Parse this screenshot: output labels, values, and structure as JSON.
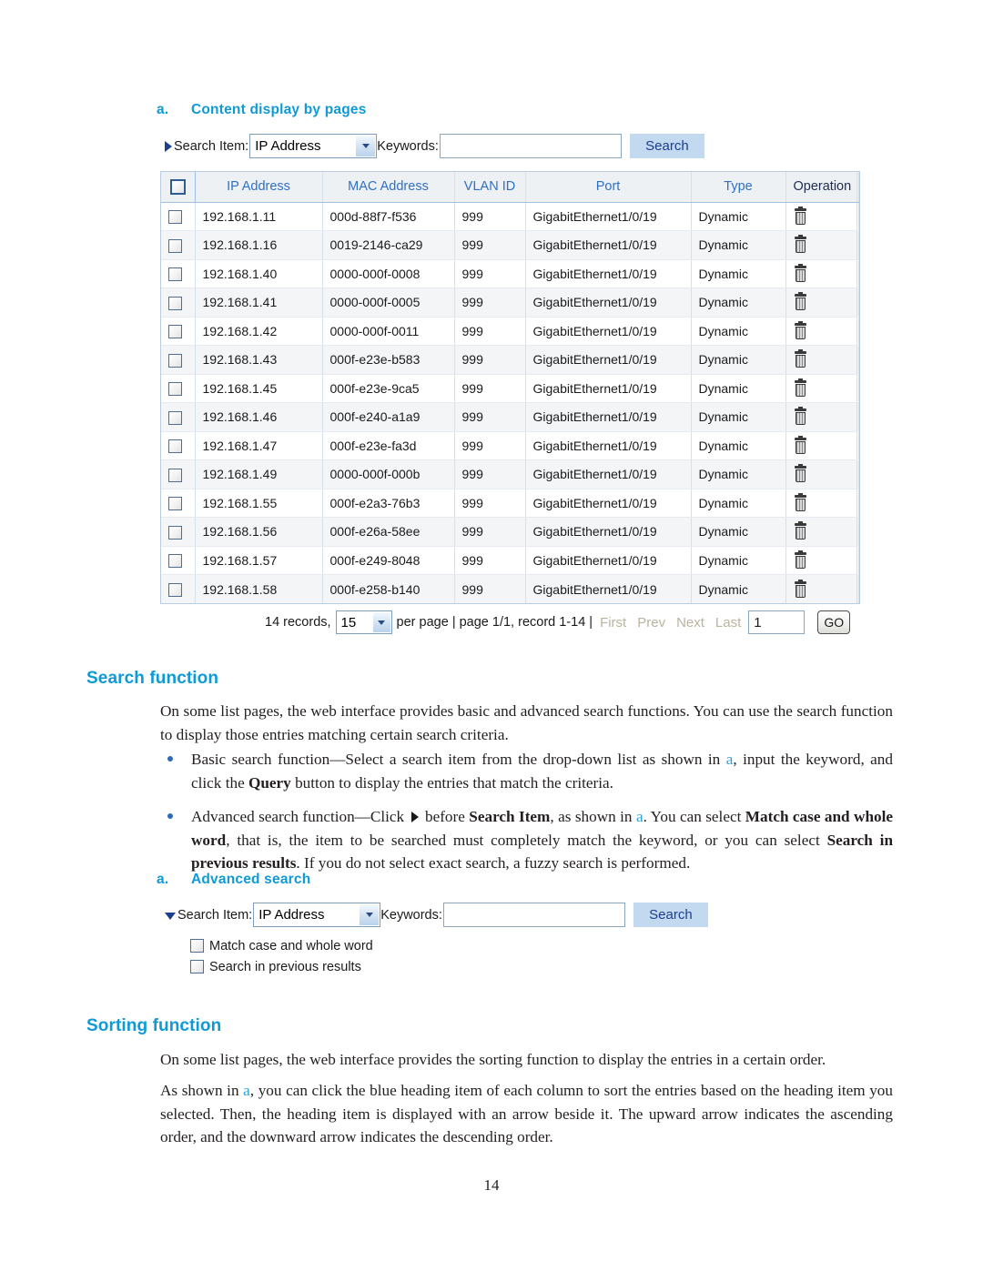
{
  "figure_a1": {
    "label": "a.",
    "title": "Content display by pages"
  },
  "figure_a2": {
    "label": "a.",
    "title": "Advanced search"
  },
  "search_bar": {
    "toggle_icon": "triangle-right-icon",
    "search_item_label": "Search Item:",
    "search_item_value": "IP Address",
    "keywords_label": "Keywords:",
    "keywords_value": "",
    "search_button": "Search"
  },
  "advanced_search_bar": {
    "toggle_icon": "triangle-down-icon",
    "search_item_label": "Search Item:",
    "search_item_value": "IP Address",
    "keywords_label": "Keywords:",
    "keywords_value": "",
    "search_button": "Search",
    "checkboxes": [
      {
        "label": "Match case and whole word",
        "checked": false
      },
      {
        "label": "Search in previous results",
        "checked": false
      }
    ]
  },
  "table": {
    "columns": [
      "IP Address",
      "MAC Address",
      "VLAN ID",
      "Port",
      "Type",
      "Operation"
    ],
    "select_all_checkbox": false,
    "delete_icon": "trash-icon",
    "rows": [
      {
        "ip": "192.168.1.11",
        "mac": "000d-88f7-f536",
        "vlan": "999",
        "port": "GigabitEthernet1/0/19",
        "type": "Dynamic"
      },
      {
        "ip": "192.168.1.16",
        "mac": "0019-2146-ca29",
        "vlan": "999",
        "port": "GigabitEthernet1/0/19",
        "type": "Dynamic"
      },
      {
        "ip": "192.168.1.40",
        "mac": "0000-000f-0008",
        "vlan": "999",
        "port": "GigabitEthernet1/0/19",
        "type": "Dynamic"
      },
      {
        "ip": "192.168.1.41",
        "mac": "0000-000f-0005",
        "vlan": "999",
        "port": "GigabitEthernet1/0/19",
        "type": "Dynamic"
      },
      {
        "ip": "192.168.1.42",
        "mac": "0000-000f-0011",
        "vlan": "999",
        "port": "GigabitEthernet1/0/19",
        "type": "Dynamic"
      },
      {
        "ip": "192.168.1.43",
        "mac": "000f-e23e-b583",
        "vlan": "999",
        "port": "GigabitEthernet1/0/19",
        "type": "Dynamic"
      },
      {
        "ip": "192.168.1.45",
        "mac": "000f-e23e-9ca5",
        "vlan": "999",
        "port": "GigabitEthernet1/0/19",
        "type": "Dynamic"
      },
      {
        "ip": "192.168.1.46",
        "mac": "000f-e240-a1a9",
        "vlan": "999",
        "port": "GigabitEthernet1/0/19",
        "type": "Dynamic"
      },
      {
        "ip": "192.168.1.47",
        "mac": "000f-e23e-fa3d",
        "vlan": "999",
        "port": "GigabitEthernet1/0/19",
        "type": "Dynamic"
      },
      {
        "ip": "192.168.1.49",
        "mac": "0000-000f-000b",
        "vlan": "999",
        "port": "GigabitEthernet1/0/19",
        "type": "Dynamic"
      },
      {
        "ip": "192.168.1.55",
        "mac": "000f-e2a3-76b3",
        "vlan": "999",
        "port": "GigabitEthernet1/0/19",
        "type": "Dynamic"
      },
      {
        "ip": "192.168.1.56",
        "mac": "000f-e26a-58ee",
        "vlan": "999",
        "port": "GigabitEthernet1/0/19",
        "type": "Dynamic"
      },
      {
        "ip": "192.168.1.57",
        "mac": "000f-e249-8048",
        "vlan": "999",
        "port": "GigabitEthernet1/0/19",
        "type": "Dynamic"
      },
      {
        "ip": "192.168.1.58",
        "mac": "000f-e258-b140",
        "vlan": "999",
        "port": "GigabitEthernet1/0/19",
        "type": "Dynamic"
      }
    ]
  },
  "pagination": {
    "records_text": "14 records,",
    "per_page_value": "15",
    "per_page_text": "per page | page 1/1, record 1-14 |",
    "first": "First",
    "prev": "Prev",
    "next": "Next",
    "last": "Last",
    "page_input_value": "1",
    "go_button": "GO"
  },
  "search_function": {
    "heading": "Search function",
    "intro": "On some list pages, the web interface provides basic and advanced search functions. You can use the search function to display those entries matching certain search criteria.",
    "bullets": [
      {
        "part1": "Basic search function—Select a search item from the drop-down list as shown in ",
        "ref": "a",
        "part2": ", input the keyword, and click the ",
        "bold1": "Query",
        "part3": " button to display the entries that match the criteria."
      },
      {
        "part1": "Advanced search function—Click ",
        "part2": " before ",
        "bold1": "Search Item",
        "part3": ", as shown in ",
        "ref": "a",
        "part4": ". You can select ",
        "bold2": "Match case and whole word",
        "part5": ", that is, the item to be searched must completely match the keyword, or you can select ",
        "bold3": "Search in previous results",
        "part6": ". If you do not select exact search, a fuzzy search is performed."
      }
    ]
  },
  "sorting_function": {
    "heading": "Sorting function",
    "para1": "On some list pages, the web interface provides the sorting function to display the entries in a certain order.",
    "para2_part1": "As shown in ",
    "para2_ref": "a",
    "para2_part2": ", you can click the blue heading item of each column to sort the entries based on the heading item you selected. Then, the heading item is displayed with an arrow beside it. The upward arrow indicates the ascending order, and the downward arrow indicates the descending order."
  },
  "footer": {
    "page_number": "14"
  }
}
